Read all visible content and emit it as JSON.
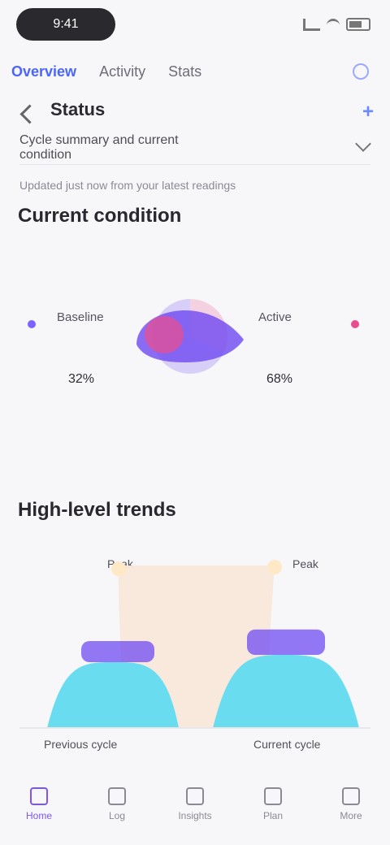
{
  "status_bar": {
    "time": "9:41"
  },
  "tabs": [
    {
      "label": "Overview",
      "active": true
    },
    {
      "label": "Activity",
      "active": false
    },
    {
      "label": "Stats",
      "active": false
    }
  ],
  "header": {
    "title": "Status",
    "subtitle": "Cycle summary and current condition",
    "info": "Updated just now from your latest readings"
  },
  "current_section": {
    "title": "Current condition",
    "left_title": "Baseline",
    "right_title": "Active",
    "left_value": "32%",
    "right_value": "68%"
  },
  "trend_section": {
    "title": "High-level trends",
    "left_peak": "Peak",
    "right_peak": "Peak",
    "left_caption": "Previous cycle",
    "right_caption": "Current cycle"
  },
  "nav": [
    {
      "label": "Home",
      "active": true
    },
    {
      "label": "Log",
      "active": false
    },
    {
      "label": "Insights",
      "active": false
    },
    {
      "label": "Plan",
      "active": false
    },
    {
      "label": "More",
      "active": false
    }
  ],
  "chart_data": [
    {
      "type": "pie",
      "categories": [
        "Baseline",
        "Active"
      ],
      "values": [
        32,
        68
      ]
    },
    {
      "type": "area",
      "categories": [
        "Previous cycle",
        "Current cycle"
      ],
      "series": [
        {
          "values": [
            18,
            20
          ]
        },
        {
          "values": [
            10,
            12
          ]
        },
        {
          "values": [
            28,
            29
          ]
        }
      ]
    }
  ],
  "colors": {
    "primary": "#6b45f2",
    "accent": "#ea4d8e",
    "cyan": "#69ddef",
    "peach": "#f9e8db"
  }
}
